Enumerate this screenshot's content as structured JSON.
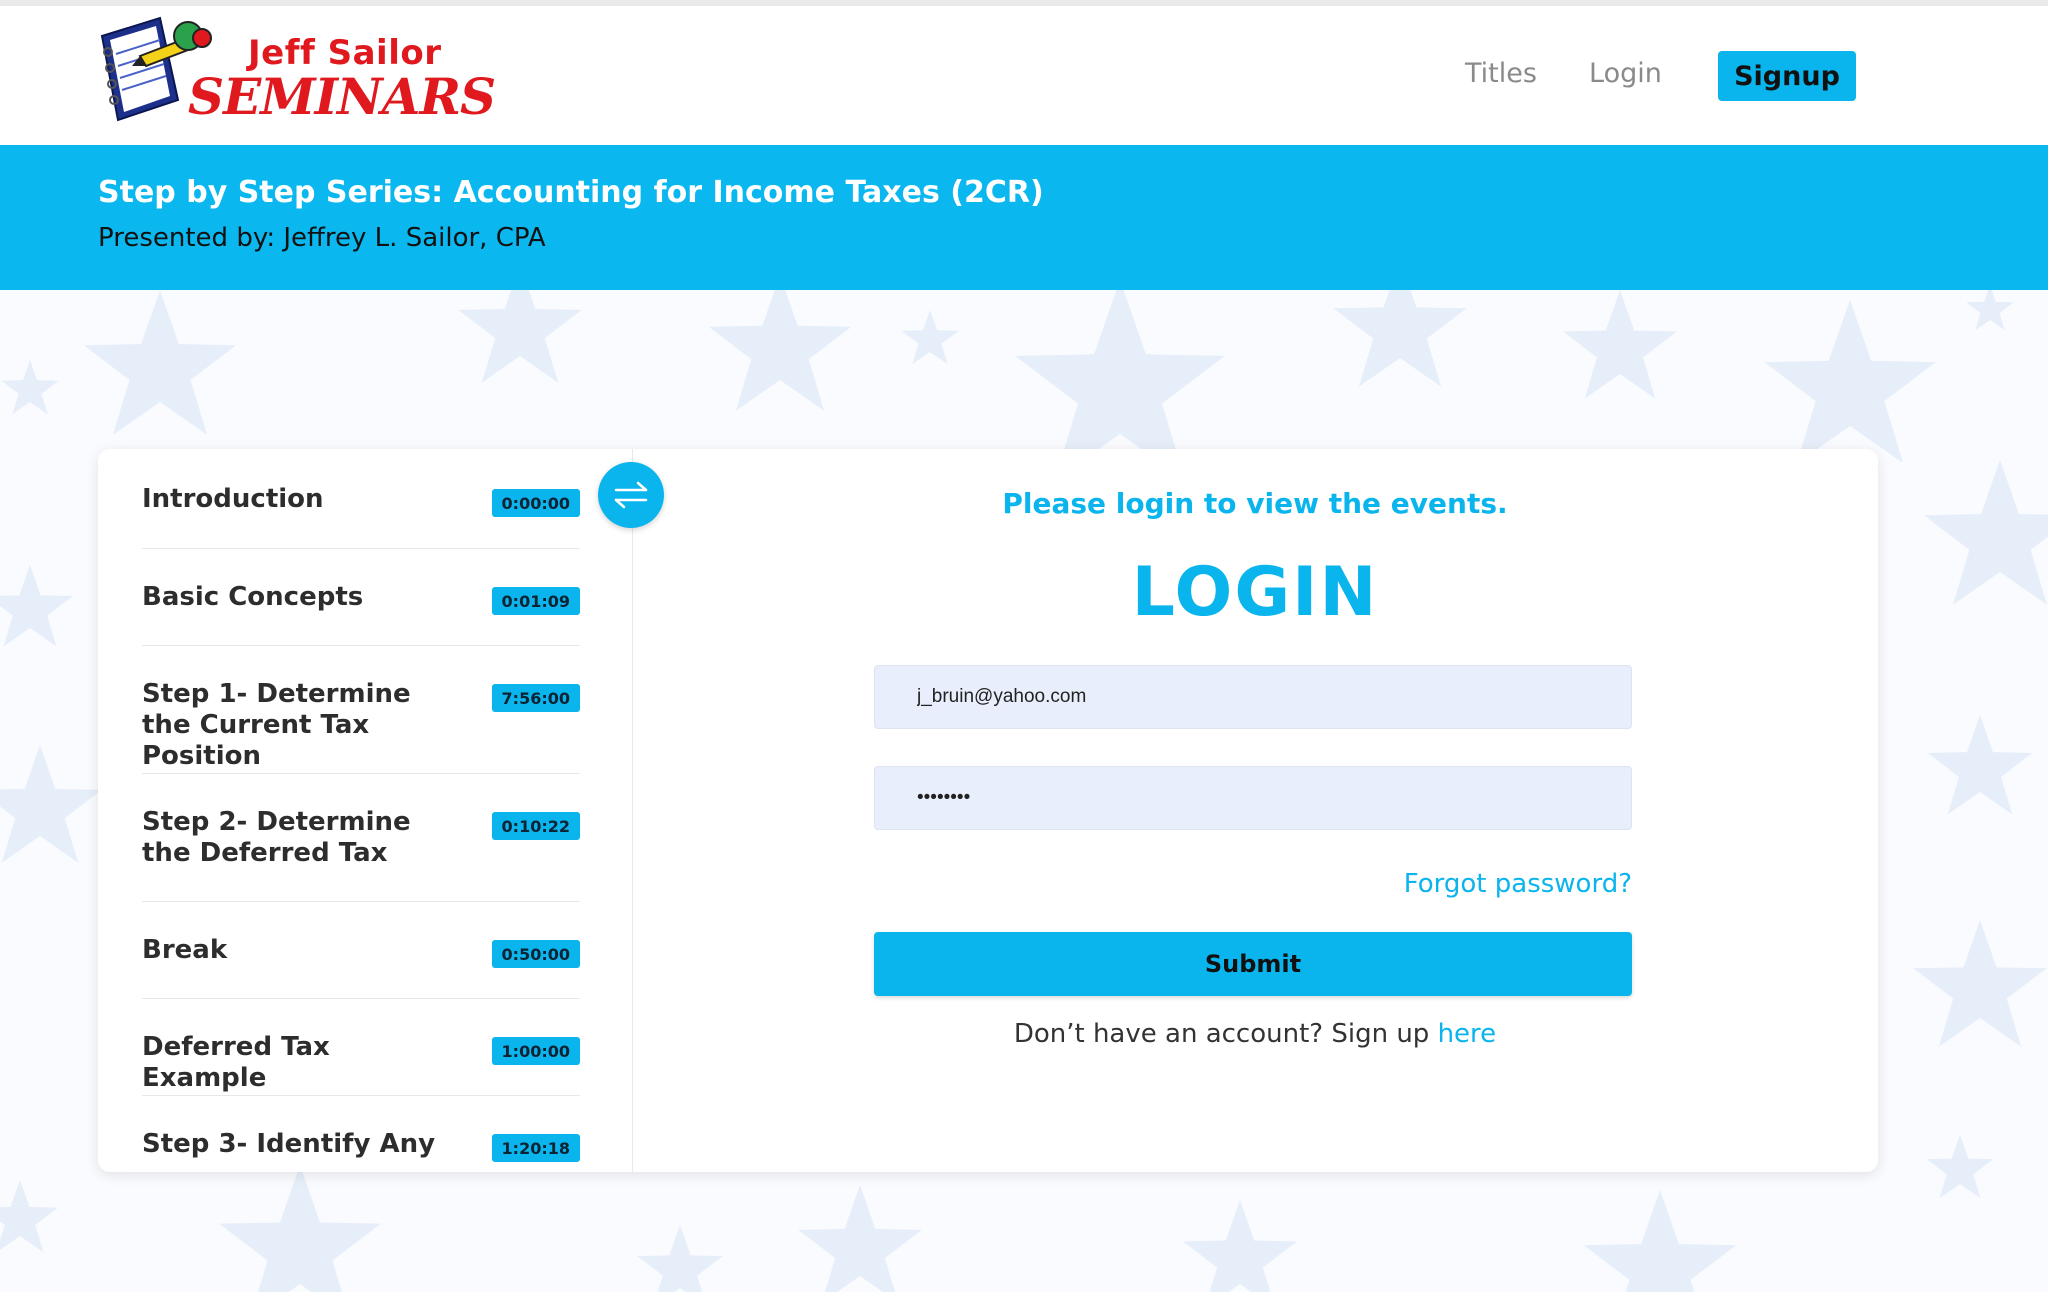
{
  "brand": {
    "logo_line1": "Jeff Sailor",
    "logo_line2": "SEMINARS"
  },
  "nav": {
    "titles": "Titles",
    "login": "Login",
    "signup": "Signup"
  },
  "banner": {
    "title": "Step by Step Series: Accounting for Income Taxes (2CR)",
    "presenter": "Presented by: Jeffrey L. Sailor, CPA"
  },
  "sessions": [
    {
      "title": "Introduction",
      "time": "0:00:00"
    },
    {
      "title": "Basic Concepts",
      "time": "0:01:09"
    },
    {
      "title": "Step 1- Determine the Current Tax Position",
      "time": "7:56:00"
    },
    {
      "title": "Step 2- Determine the Deferred Tax",
      "time": "0:10:22"
    },
    {
      "title": "Break",
      "time": "0:50:00"
    },
    {
      "title": "Deferred Tax Example",
      "time": "1:00:00"
    },
    {
      "title": "Step 3- Identify Any",
      "time": "1:20:18"
    }
  ],
  "login": {
    "prompt": "Please login to view the events.",
    "heading": "LOGIN",
    "email_value": "j_bruin@yahoo.com",
    "password_value": "••••••••",
    "forgot": "Forgot password?",
    "submit": "Submit",
    "no_account": "Don’t have an account? Sign up ",
    "here": "here"
  },
  "colors": {
    "accent": "#0ab4ec",
    "logo_red": "#e0191f",
    "field_bg": "#e8eefb"
  },
  "icons": {
    "toggle": "swap-arrows-icon",
    "logo": "notebook-pencil-icon"
  }
}
